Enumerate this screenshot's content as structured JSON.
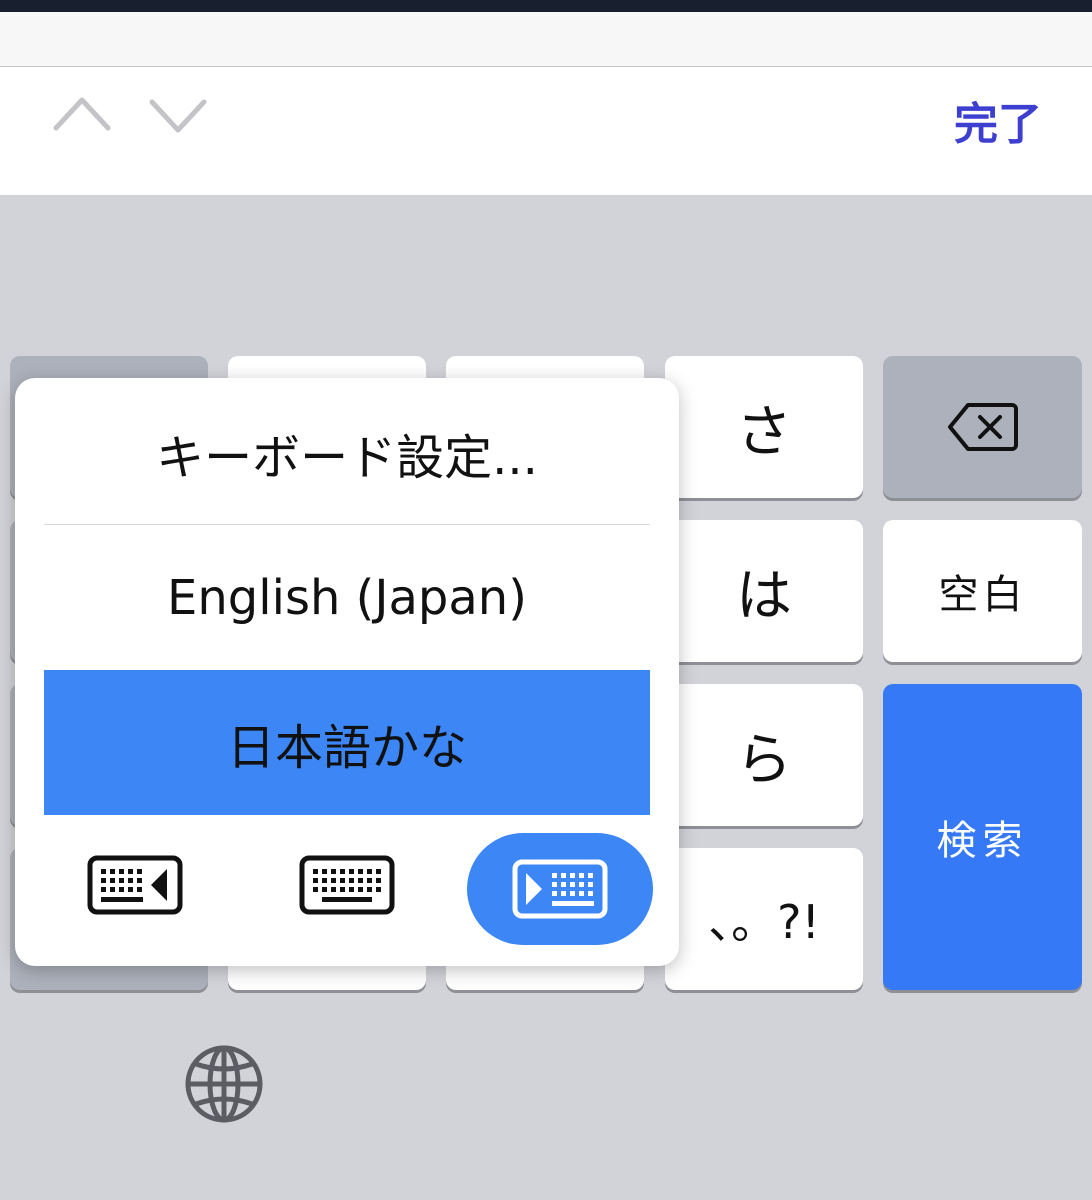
{
  "accessory": {
    "done_label": "完了"
  },
  "keys": {
    "sa": "さ",
    "ha": "は",
    "ra": "ら",
    "punct": "、。?!",
    "space": "空白",
    "search": "検索"
  },
  "popup": {
    "items": [
      {
        "label": "キーボード設定..."
      },
      {
        "label": "English (Japan)"
      },
      {
        "label": "日本語かな",
        "selected": true
      }
    ],
    "layout_icons": [
      "keyboard-left-icon",
      "keyboard-full-icon",
      "keyboard-right-icon"
    ],
    "selected_layout": "keyboard-right-icon"
  },
  "colors": {
    "accent": "#3d3fd0",
    "selected": "#3c86f5",
    "search_key": "#3579f6"
  }
}
